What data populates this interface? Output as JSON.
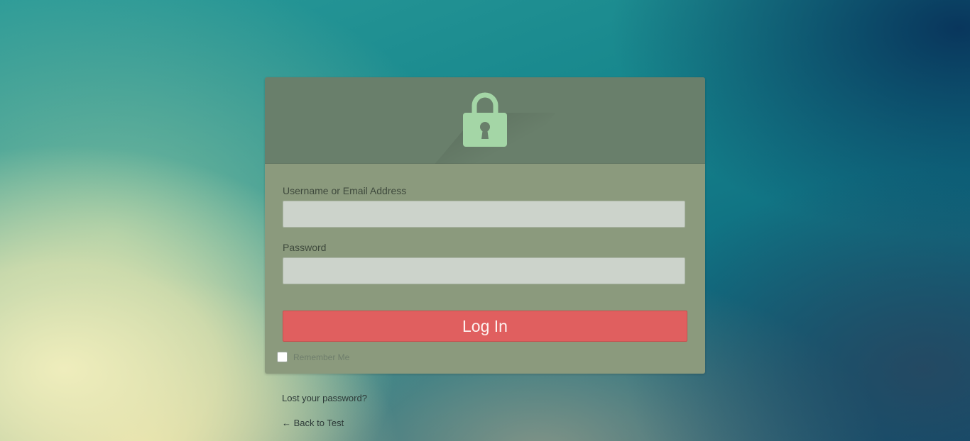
{
  "header": {
    "icon": "lock-icon",
    "colors": {
      "header_bg": "#697f6b",
      "body_bg": "#8b9a7d",
      "lock": "#a4d6a6",
      "button": "#e05f5f"
    }
  },
  "form": {
    "username_label": "Username or Email Address",
    "username_value": "",
    "password_label": "Password",
    "password_value": "",
    "login_button": "Log In",
    "remember_label": "Remember Me",
    "remember_checked": false
  },
  "links": {
    "lost_password": "Lost your password?",
    "back_to_site": "← Back to Test"
  }
}
